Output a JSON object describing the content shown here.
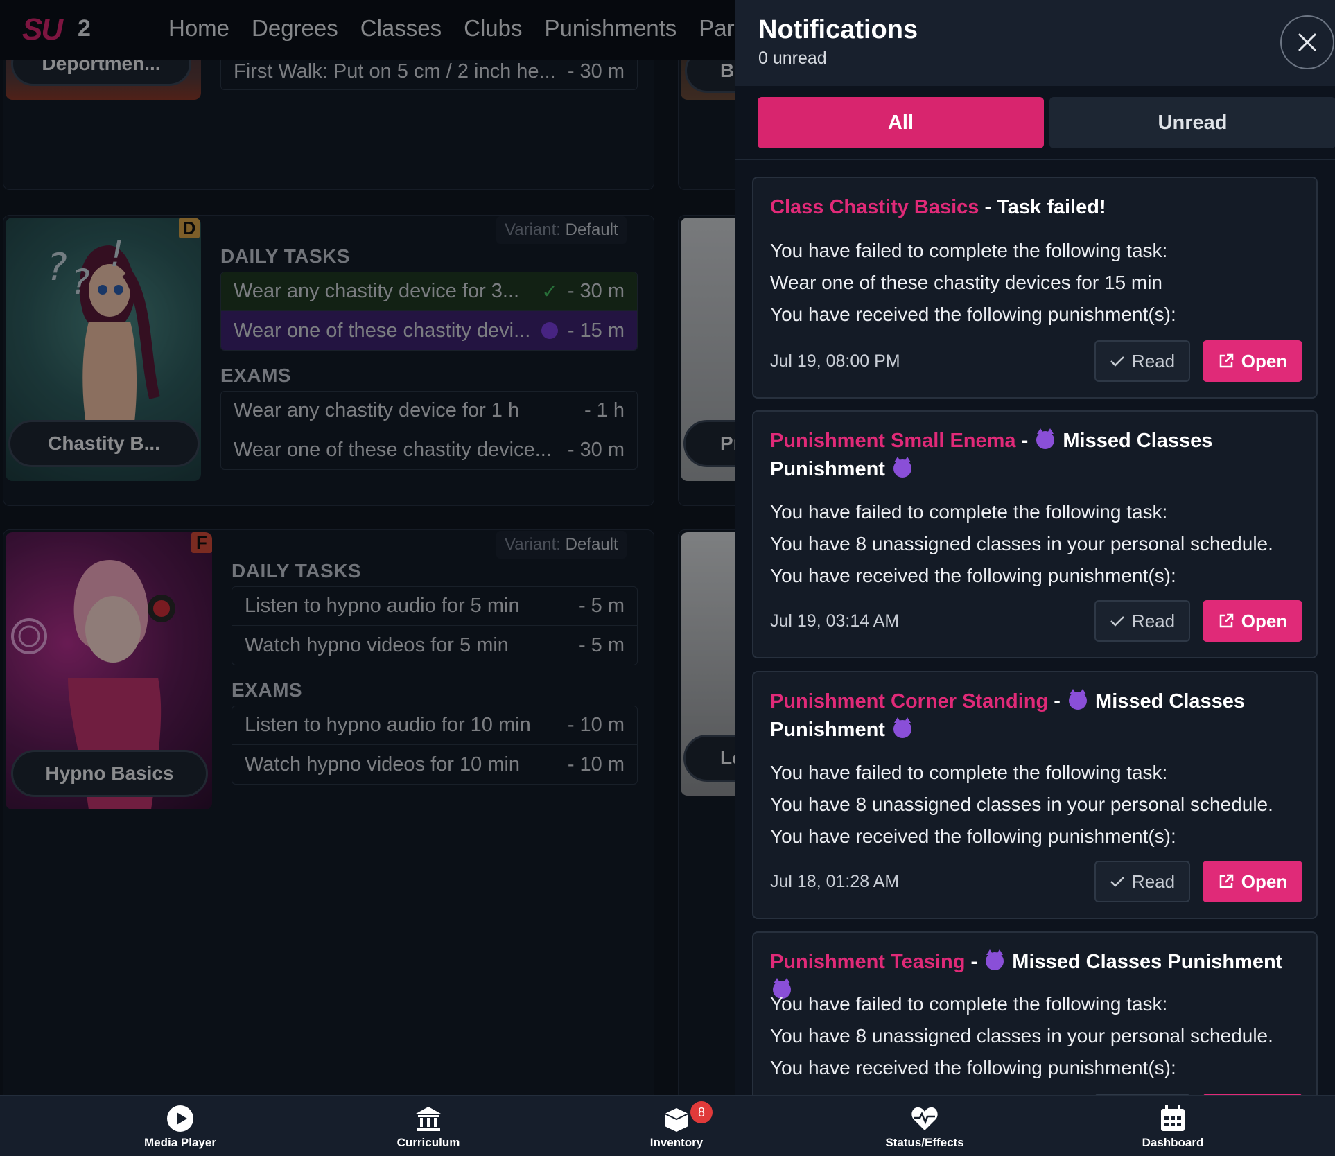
{
  "nav": {
    "logo": "SU",
    "logo_num": "2",
    "links": [
      "Home",
      "Degrees",
      "Classes",
      "Clubs",
      "Punishments",
      "Par"
    ]
  },
  "background": {
    "top_card": {
      "label": "Deportmen...",
      "task": "First Walk: Put on 5 cm / 2 inch he...",
      "task_dur": "- 30 m",
      "side_label": "Bo"
    },
    "chastity_card": {
      "grade": "D",
      "label": "Chastity B...",
      "variant_key": "Variant:",
      "variant_val": "Default",
      "daily_h": "DAILY TASKS",
      "daily": [
        {
          "text": "Wear any chastity device for 3...",
          "dur": "- 30 m"
        },
        {
          "text": "Wear one of these chastity devi...",
          "dur": "- 15 m"
        }
      ],
      "exams_h": "EXAMS",
      "exams": [
        {
          "text": "Wear any chastity device for 1 h",
          "dur": "- 1 h"
        },
        {
          "text": "Wear one of these chastity device...",
          "dur": "- 30 m"
        }
      ],
      "side_label": "Pr"
    },
    "hypno_card": {
      "grade": "F",
      "label": "Hypno Basics",
      "variant_key": "Variant:",
      "variant_val": "Default",
      "daily_h": "DAILY TASKS",
      "daily": [
        {
          "text": "Listen to hypno audio for 5 min",
          "dur": "- 5 m"
        },
        {
          "text": "Watch hypno videos for 5 min",
          "dur": "- 5 m"
        }
      ],
      "exams_h": "EXAMS",
      "exams": [
        {
          "text": "Listen to hypno audio for 10 min",
          "dur": "- 10 m"
        },
        {
          "text": "Watch hypno videos for 10 min",
          "dur": "- 10 m"
        }
      ],
      "side_label": "Lo"
    }
  },
  "drawer": {
    "title": "Notifications",
    "subtitle": "0 unread",
    "tabs": {
      "all": "All",
      "unread": "Unread"
    },
    "read_label": "Read",
    "open_label": "Open",
    "items": [
      {
        "title_pink": "Class Chastity Basics",
        "title_rest": "- Task failed!",
        "lines": [
          "You have failed to complete the following task:",
          "Wear one of these chastity devices for 15 min",
          "You have received the following punishment(s):"
        ],
        "time": "Jul 19, 08:00 PM"
      },
      {
        "title_pink": "Punishment Small Enema",
        "title_rest": "Missed Classes Punishment",
        "lines": [
          "You have failed to complete the following task:",
          "You have 8 unassigned classes in your personal schedule.",
          "You have received the following punishment(s):"
        ],
        "time": "Jul 19, 03:14 AM"
      },
      {
        "title_pink": "Punishment Corner Standing",
        "title_rest": "Missed Classes Punishment",
        "lines": [
          "You have failed to complete the following task:",
          "You have 8 unassigned classes in your personal schedule.",
          "You have received the following punishment(s):"
        ],
        "time": "Jul 18, 01:28 AM"
      },
      {
        "title_pink": "Punishment Teasing",
        "title_rest": "Missed Classes Punishment",
        "lines": [
          "You have failed to complete the following task:",
          "You have 8 unassigned classes in your personal schedule.",
          "You have received the following punishment(s):"
        ],
        "time": ""
      }
    ]
  },
  "bottombar": {
    "items": [
      {
        "label": "Media Player",
        "icon": "play-icon"
      },
      {
        "label": "Curriculum",
        "icon": "bank-icon"
      },
      {
        "label": "Inventory",
        "icon": "box-icon",
        "badge": "8"
      },
      {
        "label": "Status/Effects",
        "icon": "heart-pulse-icon"
      },
      {
        "label": "Dashboard",
        "icon": "calendar-icon"
      }
    ]
  },
  "colors": {
    "accent": "#e02a78",
    "panel": "#141b26",
    "bg": "#0d131d"
  }
}
